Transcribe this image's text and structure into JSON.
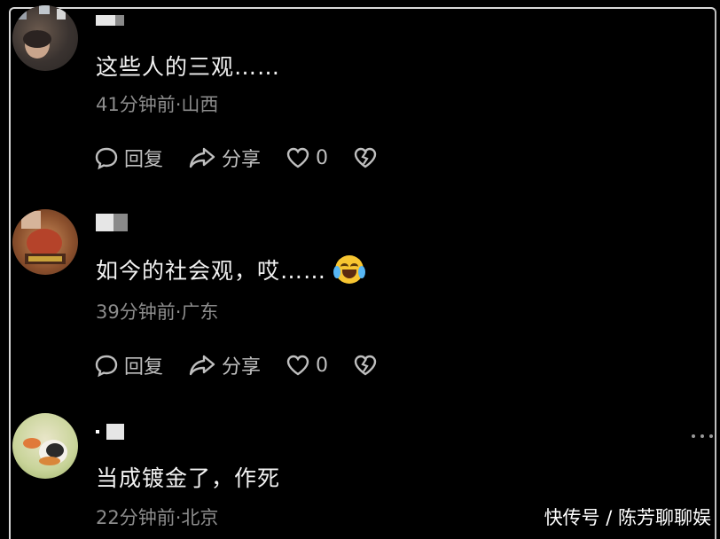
{
  "comments": [
    {
      "text": "这些人的三观……",
      "meta": "41分钟前·山西",
      "reply_label": "回复",
      "share_label": "分享",
      "like_count": "0"
    },
    {
      "text": "如今的社会观，哎……",
      "meta": "39分钟前·广东",
      "reply_label": "回复",
      "share_label": "分享",
      "like_count": "0"
    },
    {
      "text": "当成镀金了，作死",
      "meta": "22分钟前·北京"
    }
  ],
  "watermark": "快传号 / 陈芳聊聊娱",
  "colors": {
    "background": "#000000",
    "text": "#f2f2f2",
    "meta": "#8c8c8c",
    "action": "#bfbfbf"
  },
  "icons": [
    "reply-icon",
    "share-icon",
    "like-icon",
    "dislike-icon",
    "more-icon"
  ]
}
